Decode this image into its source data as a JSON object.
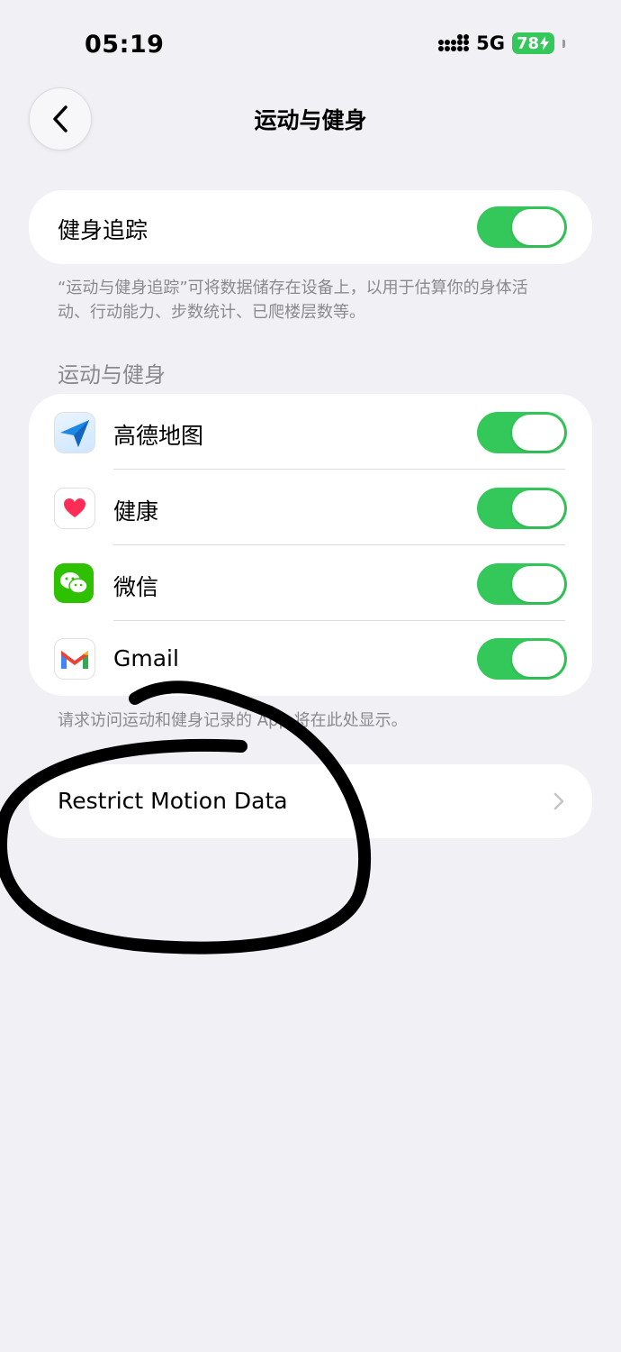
{
  "status_bar": {
    "time": "05:19",
    "network": "5G",
    "battery": "78"
  },
  "nav": {
    "title": "运动与健身"
  },
  "fitness_tracking": {
    "label": "健身追踪",
    "enabled": true,
    "footer": "“运动与健身追踪”可将数据储存在设备上，以用于估算你的身体活动、行动能力、步数统计、已爬楼层数等。"
  },
  "apps_section": {
    "header": "运动与健身",
    "apps": [
      {
        "name": "高德地图",
        "icon": "amap-icon",
        "enabled": true
      },
      {
        "name": "健康",
        "icon": "health-heart-icon",
        "enabled": true
      },
      {
        "name": "微信",
        "icon": "wechat-icon",
        "enabled": true
      },
      {
        "name": "Gmail",
        "icon": "gmail-icon",
        "enabled": true
      }
    ],
    "footer": "请求访问运动和健身记录的 App 将在此处显示。"
  },
  "restrict": {
    "label": "Restrict Motion Data"
  },
  "colors": {
    "accent_green": "#34c759",
    "background": "#f0f0f5"
  }
}
